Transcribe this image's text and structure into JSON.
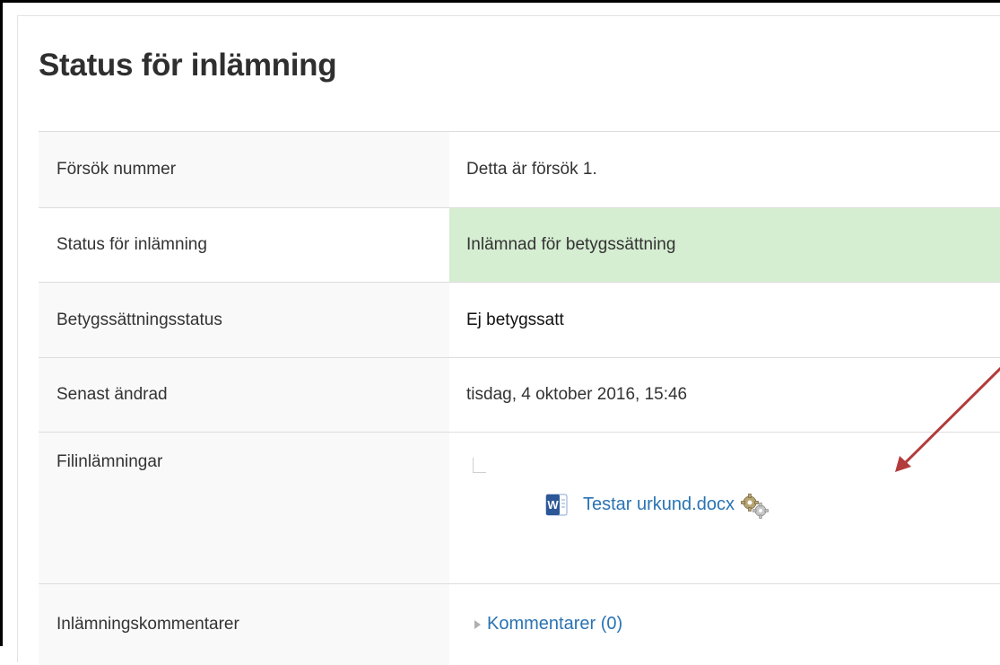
{
  "page": {
    "title": "Status för inlämning"
  },
  "rows": [
    {
      "label": "Försök nummer",
      "value": "Detta är försök 1."
    },
    {
      "label": "Status för inlämning",
      "value": "Inlämnad för betygssättning"
    },
    {
      "label": "Betygssättningsstatus",
      "value": "Ej betygssatt"
    },
    {
      "label": "Senast ändrad",
      "value": "tisdag, 4 oktober 2016, 15:46"
    },
    {
      "label": "Filinlämningar",
      "file": "Testar urkund.docx"
    },
    {
      "label": "Inlämningskommentarer",
      "comments_link": "Kommentarer (0)"
    }
  ],
  "icons": {
    "file_type": "word-document-icon",
    "plagiarism": "gear-icon",
    "expand": "caret-right-icon"
  },
  "colors": {
    "submitted_status_bg": "#d5edd1",
    "link": "#2a73b3",
    "annotation_arrow": "#b23b3b"
  }
}
